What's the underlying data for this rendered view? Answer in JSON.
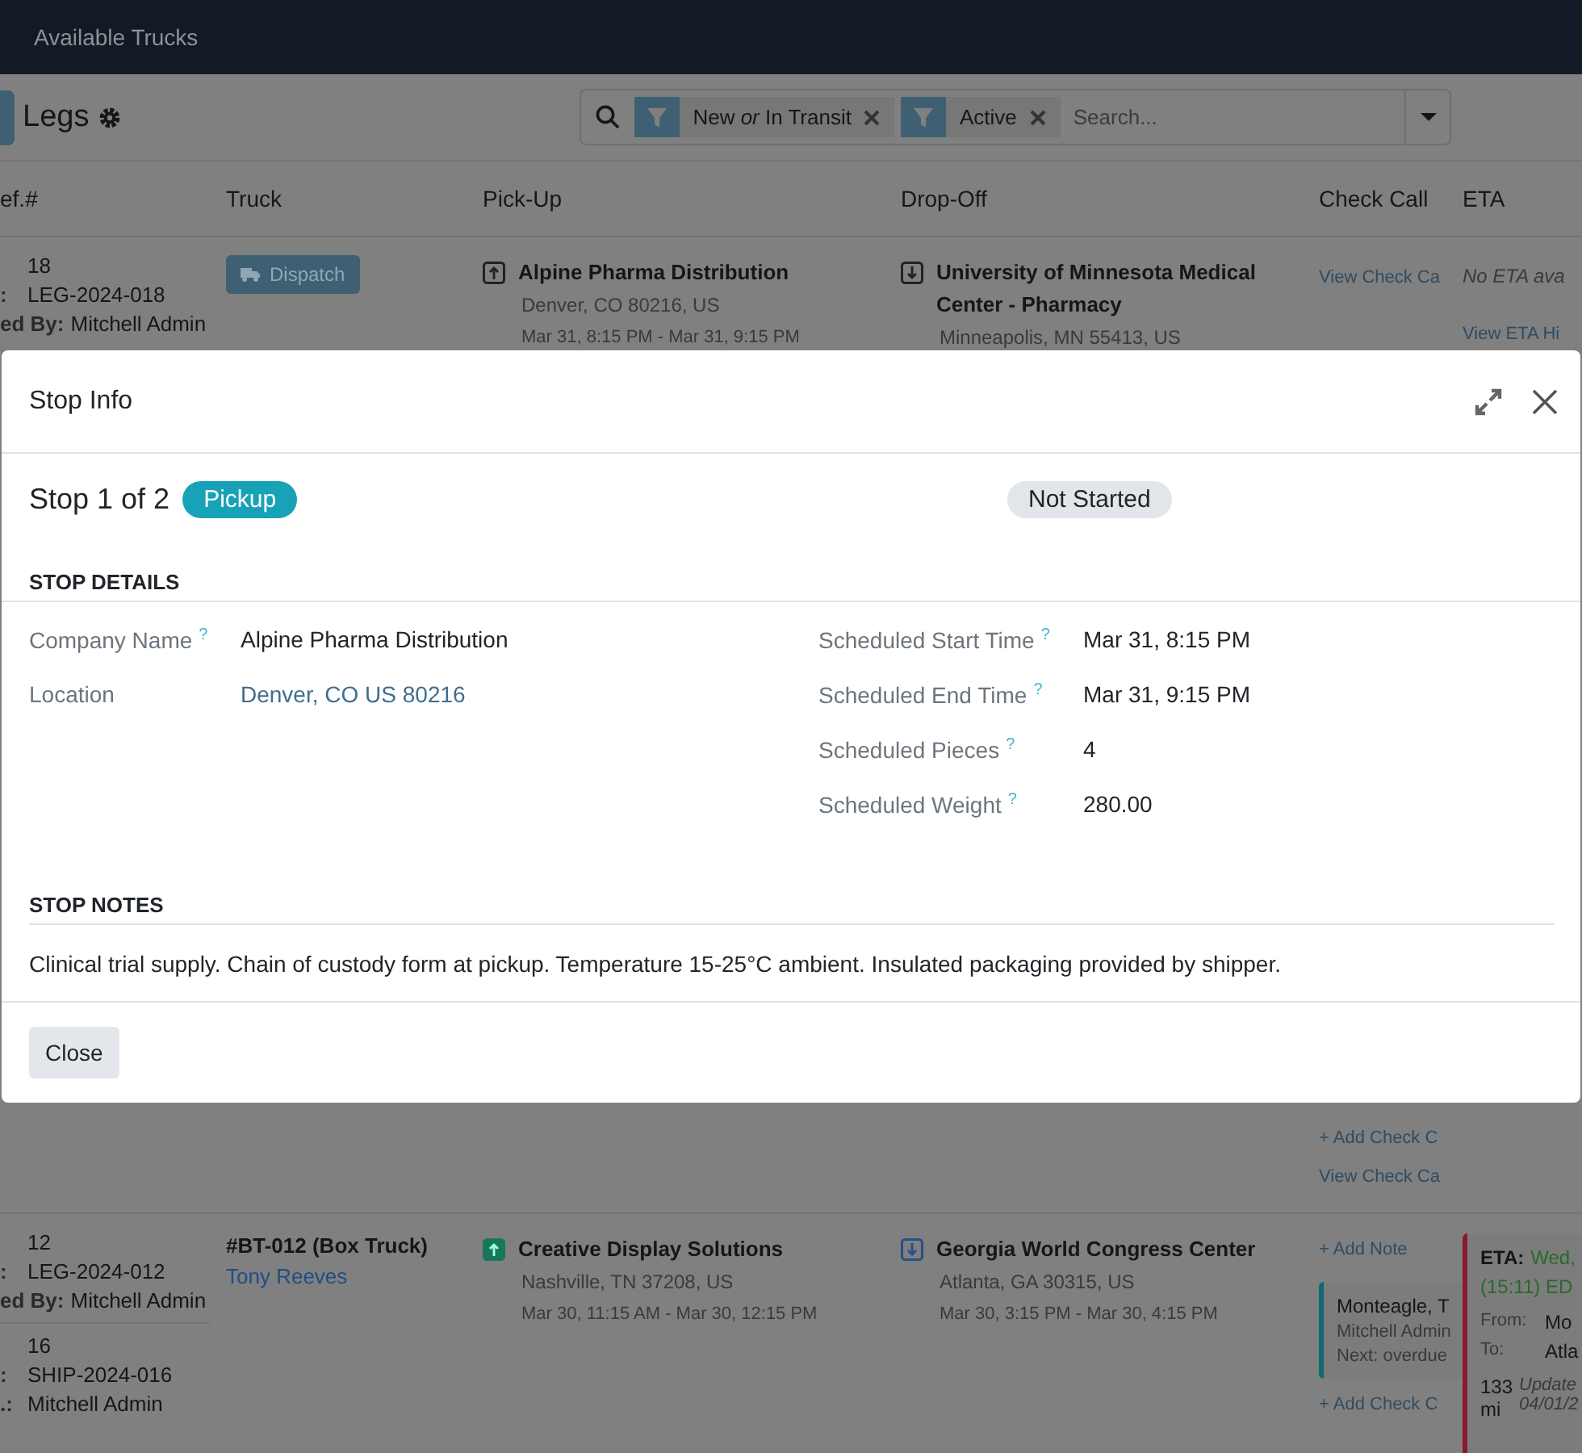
{
  "navbar": {
    "items": [
      "Available Trucks"
    ]
  },
  "control_panel": {
    "title": "Legs",
    "search": {
      "facets": [
        {
          "text": "New *or* In Transit"
        },
        {
          "text": "Active"
        }
      ],
      "placeholder": "Search..."
    }
  },
  "table": {
    "columns": [
      "ef.#",
      "Truck",
      "Pick-Up",
      "Drop-Off",
      "Check Call",
      "ETA"
    ],
    "rows": [
      {
        "refs": [
          {
            "lines": [
              {
                "value": "18"
              },
              {
                "label": ":",
                "value": "LEG-2024-018"
              },
              {
                "label": "ed By:",
                "value": "Mitchell Admin"
              }
            ]
          }
        ],
        "truck": {
          "kind": "dispatch",
          "text": "Dispatch"
        },
        "pickup": {
          "kind": "pickup",
          "active": false,
          "name": "Alpine Pharma Distribution",
          "address": "Denver, CO 80216, US",
          "window": "Mar 31, 8:15 PM - Mar 31, 9:15 PM"
        },
        "dropoff": {
          "kind": "dropoff",
          "active": false,
          "name": "University of Minnesota Medical Center - Pharmacy",
          "address": "Minneapolis, MN 55413, US"
        },
        "check_call": {
          "top_links": [
            "View Check Ca"
          ],
          "bottom_links": [
            "+ Add Check C",
            "View Check Ca"
          ]
        },
        "eta": {
          "kind": "none",
          "text": "No ETA ava",
          "link": "View ETA Hi"
        }
      },
      {
        "refs": [
          {
            "lines": [
              {
                "value": "12"
              },
              {
                "label": ":",
                "value": "LEG-2024-012"
              },
              {
                "label": "ed By:",
                "value": "Mitchell Admin"
              }
            ]
          },
          {
            "lines": [
              {
                "value": "16"
              },
              {
                "label": ":",
                "value": "SHIP-2024-016"
              },
              {
                "label": ".:",
                "value": "Mitchell Admin"
              }
            ]
          }
        ],
        "truck": {
          "kind": "assigned",
          "text": "#BT-012 (Box Truck)",
          "driver": "Tony Reeves"
        },
        "pickup": {
          "kind": "pickup",
          "active": true,
          "name": "Creative Display Solutions",
          "address": "Nashville, TN 37208, US",
          "window": "Mar 30, 11:15 AM - Mar 30, 12:15 PM"
        },
        "dropoff": {
          "kind": "dropoff",
          "active": true,
          "name": "Georgia World Congress Center",
          "address": "Atlanta, GA 30315, US",
          "window": "Mar 30, 3:15 PM - Mar 30, 4:15 PM"
        },
        "check_call": {
          "top_links": [
            "+ Add Note"
          ],
          "note": {
            "title": "Monteagle, T",
            "author": "Mitchell Admin",
            "next": "Next: overdue"
          },
          "bottom_links": [
            "+ Add Check C"
          ]
        },
        "eta": {
          "kind": "card",
          "label": "ETA:",
          "date": "Wed,",
          "time": "(15:11) ED",
          "from_label": "From:",
          "from": "Mo",
          "to_label": "To:",
          "to": "Atla",
          "distance": "133 mi",
          "updated": "Update",
          "updated_date": "04/01/2"
        }
      }
    ]
  },
  "modal": {
    "title": "Stop Info",
    "stop": "Stop 1 of 2",
    "type": "Pickup",
    "status": "Not Started",
    "details_heading": "STOP DETAILS",
    "left_fields": [
      {
        "label": "Company Name",
        "help": "?",
        "value": "Alpine Pharma Distribution",
        "kind": "text"
      },
      {
        "label": "Location",
        "value": "Denver, CO US 80216",
        "kind": "link"
      }
    ],
    "right_fields": [
      {
        "label": "Scheduled Start Time",
        "help": "?",
        "value": "Mar 31, 8:15 PM",
        "kind": "text"
      },
      {
        "label": "Scheduled End Time",
        "help": "?",
        "value": "Mar 31, 9:15 PM",
        "kind": "text"
      },
      {
        "label": "Scheduled Pieces",
        "help": "?",
        "value": "4",
        "kind": "text"
      },
      {
        "label": "Scheduled Weight",
        "help": "?",
        "value": "280.00",
        "kind": "text"
      }
    ],
    "notes_heading": "STOP NOTES",
    "notes": "Clinical trial supply. Chain of custody form at pickup. Temperature 15-25°C ambient. Insulated packaging provided by shipper.",
    "close_button": "Close"
  }
}
